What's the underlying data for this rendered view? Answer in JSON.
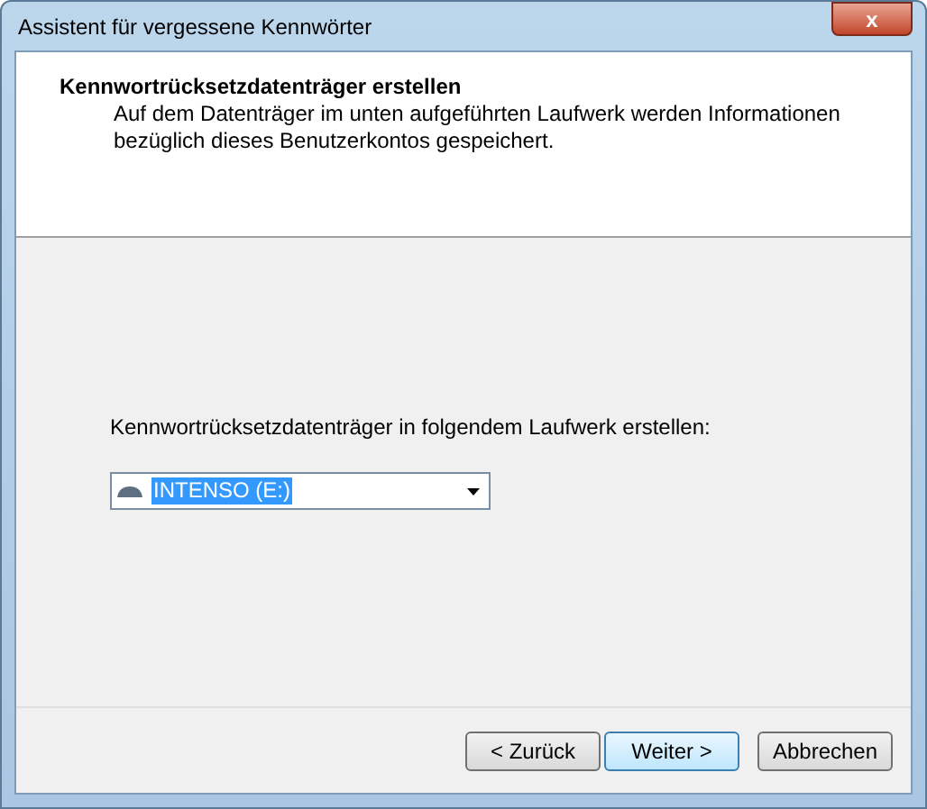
{
  "window": {
    "title": "Assistent für vergessene Kennwörter",
    "close": "x"
  },
  "header": {
    "title": "Kennwortrücksetzdatenträger erstellen",
    "description": "Auf dem Datenträger im unten aufgeführten Laufwerk werden Informationen bezüglich dieses Benutzerkontos gespeichert."
  },
  "drive": {
    "label": "Kennwortrücksetzdatenträger in folgendem Laufwerk erstellen:",
    "value": "INTENSO (E:)"
  },
  "buttons": [
    {
      "label": "< Zurück",
      "default": false
    },
    {
      "label": "Weiter >",
      "default": true
    },
    {
      "label": "Abbrechen",
      "default": false
    }
  ]
}
